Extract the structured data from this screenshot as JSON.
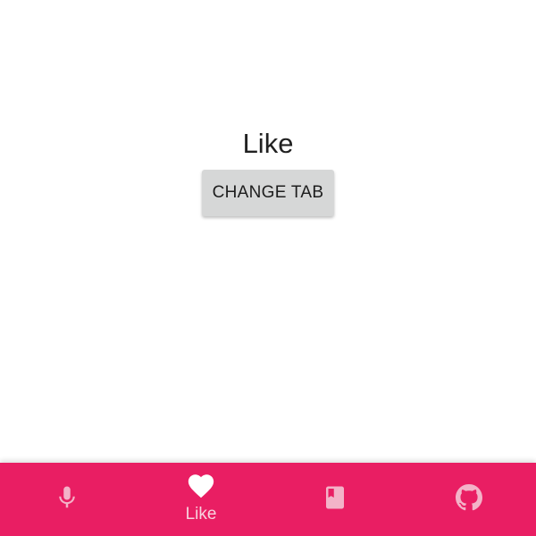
{
  "main": {
    "title": "Like",
    "change_tab_label": "CHANGE TAB"
  },
  "bottom_nav": {
    "active_index": 1,
    "colors": {
      "background": "#e91e63",
      "icon_active": "#ffffff",
      "icon_inactive": "#f3b3c8",
      "label": "#f7d3de"
    },
    "items": [
      {
        "icon": "mic-icon",
        "label": ""
      },
      {
        "icon": "heart-icon",
        "label": "Like"
      },
      {
        "icon": "book-icon",
        "label": ""
      },
      {
        "icon": "github-icon",
        "label": ""
      }
    ]
  }
}
